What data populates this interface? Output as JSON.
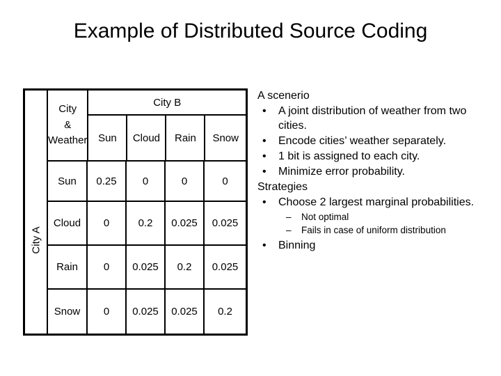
{
  "slide": {
    "title": "Example of Distributed Source Coding"
  },
  "table": {
    "corner_line1": "City",
    "corner_line2": "&",
    "corner_line3": "Weather",
    "column_group_header": "City B",
    "row_group_header": "City A",
    "column_headers": [
      "Sun",
      "Cloud",
      "Rain",
      "Snow"
    ],
    "row_headers": [
      "Sun",
      "Cloud",
      "Rain",
      "Snow"
    ],
    "rows": [
      {
        "label": "Sun",
        "values": [
          "0.25",
          "0",
          "0",
          "0"
        ]
      },
      {
        "label": "Cloud",
        "values": [
          "0",
          "0.2",
          "0.025",
          "0.025"
        ]
      },
      {
        "label": "Rain",
        "values": [
          "0",
          "0.025",
          "0.2",
          "0.025"
        ]
      },
      {
        "label": "Snow",
        "values": [
          "0",
          "0.025",
          "0.025",
          "0.2"
        ]
      }
    ]
  },
  "notes": {
    "scenario_heading": "A scenerio",
    "scenario_bullets": [
      "A joint distribution of weather from two cities.",
      "Encode cities’ weather separately.",
      "1 bit is assigned to each city.",
      "Minimize error probability."
    ],
    "strategies_heading": "Strategies",
    "strategy_bullet_1": "Choose 2 largest marginal probabilities.",
    "strategy_sub_bullets": [
      "Not optimal",
      "Fails in case of uniform distribution"
    ],
    "strategy_bullet_2": "Binning",
    "bullet_glyph": "•",
    "dash_glyph": "–"
  },
  "colors": {
    "background": "#ffffff",
    "text": "#000000",
    "table_border": "#000000"
  }
}
